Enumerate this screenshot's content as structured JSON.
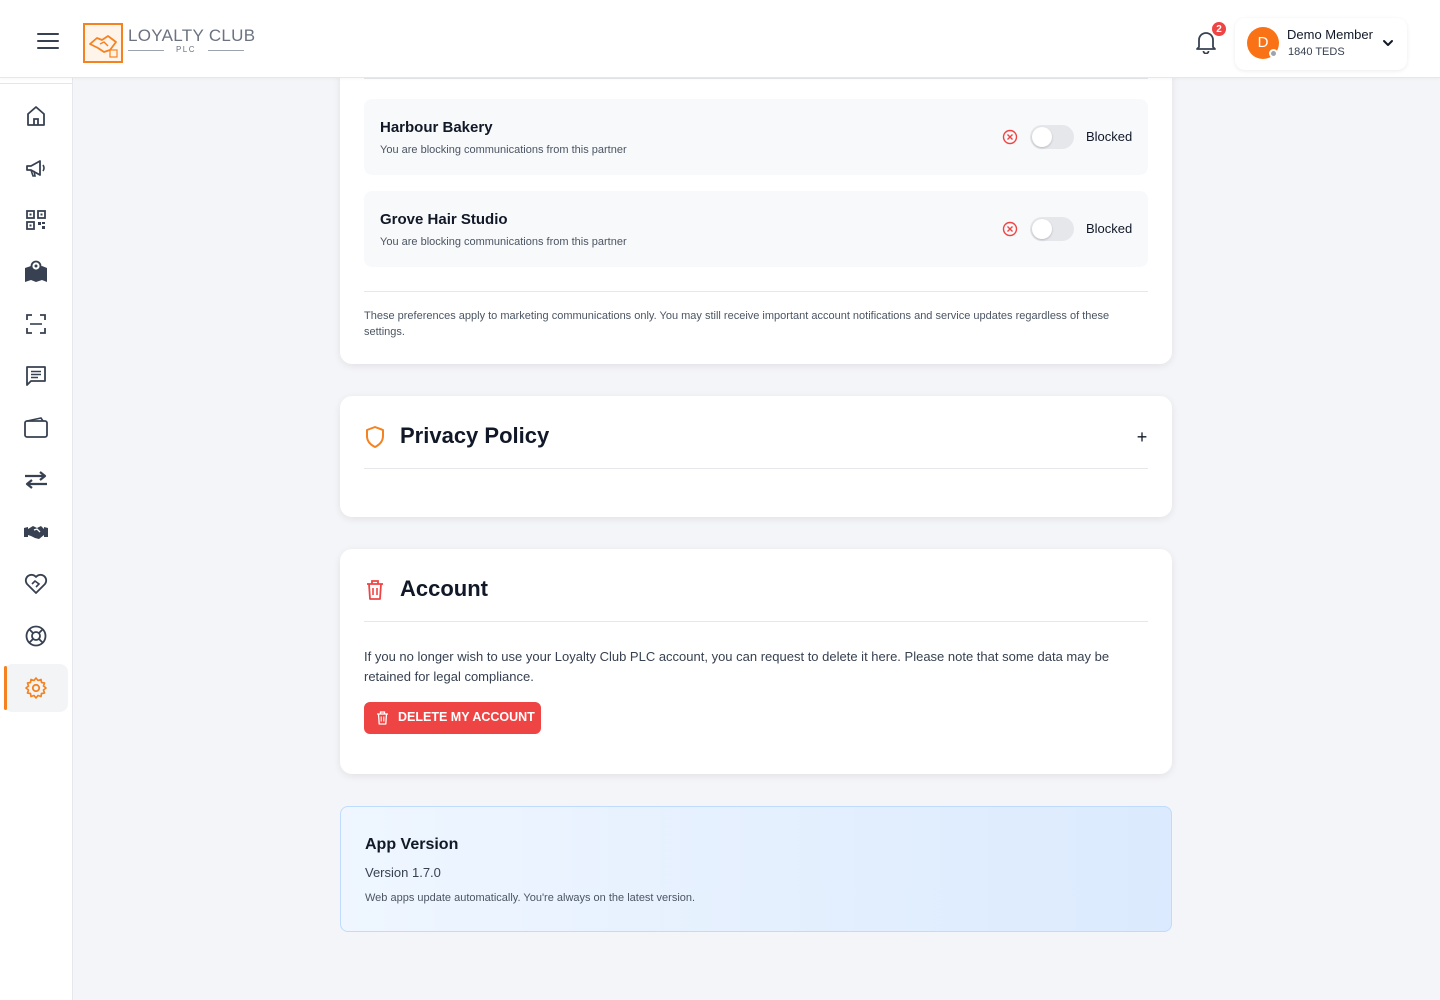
{
  "header": {
    "logo_text": "LOYALTY CLUB",
    "logo_sub": "PLC",
    "notification_count": "2",
    "user_name": "Demo Member",
    "user_points": "1840 TEDS",
    "avatar_initial": "D"
  },
  "sidebar": {
    "items": [
      {
        "icon": "home-icon"
      },
      {
        "icon": "megaphone-icon"
      },
      {
        "icon": "qr-code-icon"
      },
      {
        "icon": "map-icon"
      },
      {
        "icon": "scan-icon"
      },
      {
        "icon": "messages-icon"
      },
      {
        "icon": "wallet-icon"
      },
      {
        "icon": "transfer-icon"
      },
      {
        "icon": "handshake-icon"
      },
      {
        "icon": "heart-handshake-icon"
      },
      {
        "icon": "support-icon"
      },
      {
        "icon": "settings-icon",
        "active": true
      }
    ]
  },
  "communications": {
    "partners": [
      {
        "name": "Harbour Bakery",
        "description": "You are blocking communications from this partner",
        "status": "Blocked"
      },
      {
        "name": "Grove Hair Studio",
        "description": "You are blocking communications from this partner",
        "status": "Blocked"
      }
    ],
    "note": "These preferences apply to marketing communications only. You may still receive important account notifications and service updates regardless of these settings."
  },
  "privacy": {
    "title": "Privacy Policy",
    "expand_symbol": "+"
  },
  "account": {
    "title": "Account",
    "description": "If you no longer wish to use your Loyalty Club PLC account, you can request to delete it here. Please note that some data may be retained for legal compliance.",
    "delete_label": "DELETE MY ACCOUNT"
  },
  "app_version": {
    "title": "App Version",
    "version": "Version 1.7.0",
    "note": "Web apps update automatically. You're always on the latest version."
  },
  "colors": {
    "brand": "#f58220",
    "danger": "#ef4444",
    "text": "#111827"
  }
}
